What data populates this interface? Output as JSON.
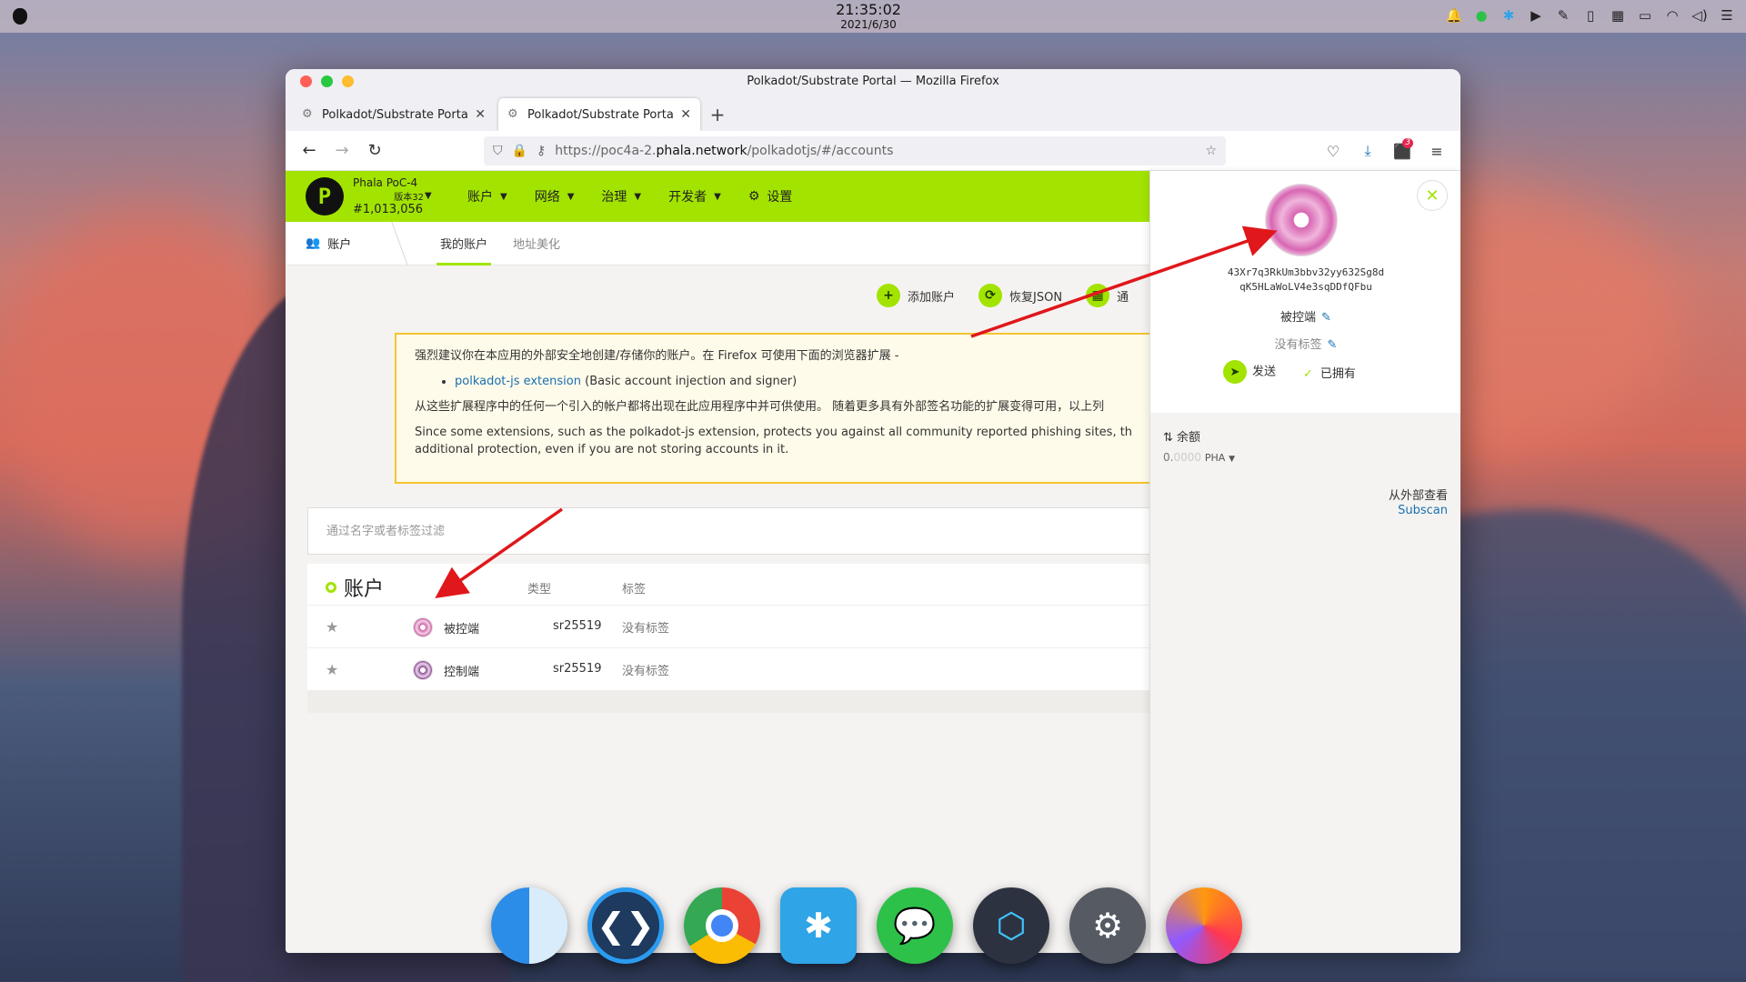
{
  "menubar": {
    "time": "21:35:02",
    "date": "2021/6/30",
    "tray_icons": [
      "bell-icon",
      "wechat-tray-icon",
      "snipaste-tray-icon",
      "play-icon",
      "feather-icon",
      "clipboard-icon",
      "grid-icon",
      "battery-icon",
      "wifi-icon",
      "volume-icon",
      "tray-menu-icon"
    ]
  },
  "window": {
    "title": "Polkadot/Substrate Portal — Mozilla Firefox",
    "tabs": [
      {
        "label": "Polkadot/Substrate Portal",
        "active": false
      },
      {
        "label": "Polkadot/Substrate Portal",
        "active": true
      }
    ],
    "url_prefix": "https://poc4a-2.",
    "url_domain": "phala.network",
    "url_path": "/polkadotjs/#/accounts",
    "extension_badge": "3"
  },
  "app": {
    "logo_letter": "P",
    "chain_name": "Phala PoC-4",
    "chain_version": "版本32",
    "block_number": "#1,013,056",
    "menu": [
      "账户",
      "网络",
      "治理",
      "开发者",
      "设置"
    ],
    "subnav": {
      "section": "账户",
      "tabs": [
        "我的账户",
        "地址美化"
      ]
    },
    "actions": [
      "添加账户",
      "恢复JSON",
      "通"
    ],
    "warning": {
      "line1": "强烈建议你在本应用的外部安全地创建/存储你的账户。在 Firefox 可使用下面的浏览器扩展 -",
      "ext_link": "polkadot-js extension",
      "ext_desc": " (Basic account injection and signer)",
      "line2": "从这些扩展程序中的任何一个引入的帐户都将出现在此应用程序中并可供使用。 随着更多具有外部签名功能的扩展变得可用，以上列",
      "line3a": "Since some extensions, such as the polkadot-js extension, protects you against all community reported phishing sites, there are vali",
      "line3b": "additional protection, even if you are not storing accounts in it."
    },
    "filter_placeholder": "通过名字或者标签过滤",
    "table": {
      "title": "账户",
      "col_type": "类型",
      "col_tags": "标签",
      "rows": [
        {
          "name": "被控端",
          "type": "sr25519",
          "tags": "没有标签"
        },
        {
          "name": "控制端",
          "type": "sr25519",
          "tags": "没有标签"
        }
      ]
    }
  },
  "sidepanel": {
    "address_line1": "43Xr7q3RkUm3bbv32yy632Sg8d",
    "address_line2": "qK5HLaWoLV4e3sqDDfQFbu",
    "account_name": "被控端",
    "tags": "没有标签",
    "send_label": "发送",
    "owned_label": "已拥有",
    "balance_label": "余额",
    "balance_int": "0.",
    "balance_dec": "0000",
    "balance_unit": "PHA",
    "external_label": "从外部查看",
    "external_link": "Subscan"
  },
  "dock": [
    "finder-icon",
    "vscode-icon",
    "chrome-icon",
    "snipaste-icon",
    "wechat-icon",
    "monitor-icon",
    "system-settings-icon",
    "firefox-icon"
  ],
  "colors": {
    "accent": "#a2e400",
    "link": "#1a6fb0",
    "warning_border": "#f4c430",
    "arrow": "#e0171b"
  }
}
